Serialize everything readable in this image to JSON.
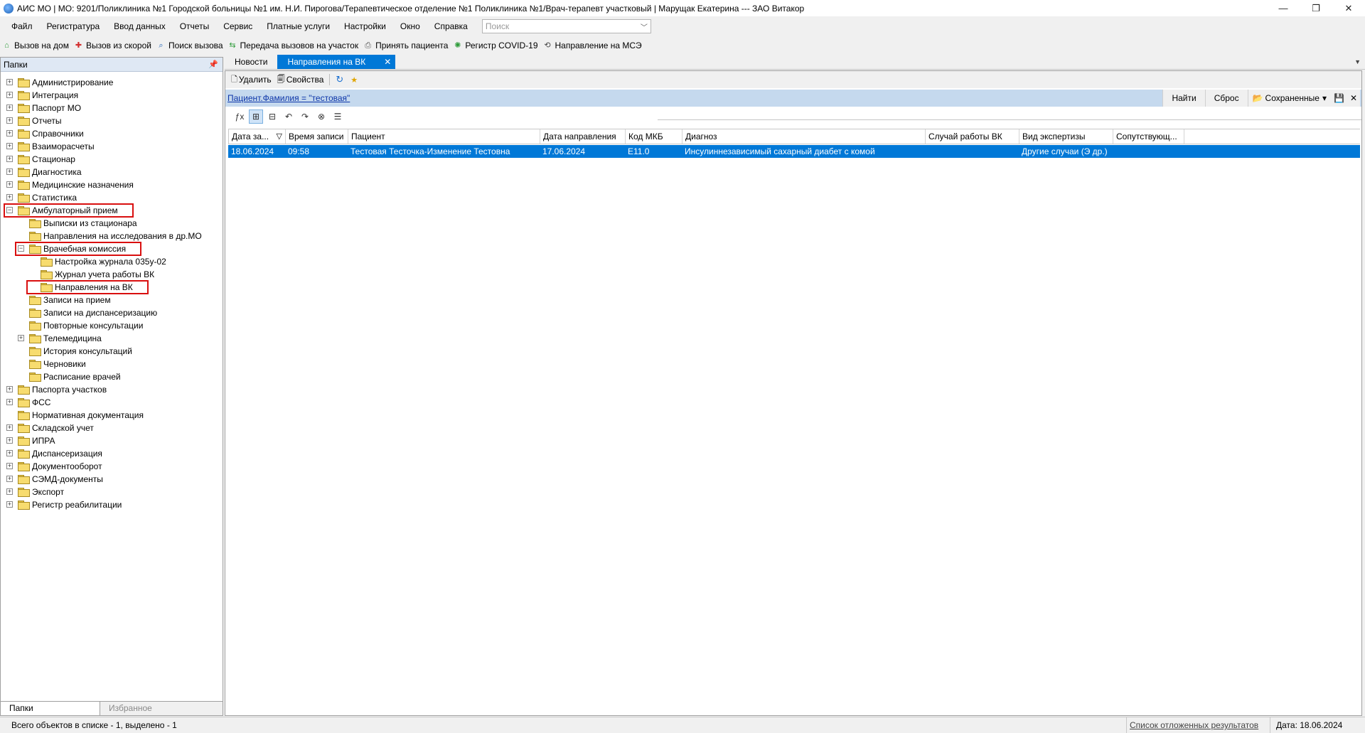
{
  "window": {
    "title": "АИС МО | МО: 9201/Поликлиника №1 Городской больницы №1 им. Н.И. Пирогова/Терапевтическое отделение №1 Поликлиника №1/Врач-терапевт участковый | Марущак Екатерина --- ЗАО Витакор",
    "minimize": "—",
    "maximize": "❐",
    "close": "✕"
  },
  "menu": {
    "items": [
      "Файл",
      "Регистратура",
      "Ввод данных",
      "Отчеты",
      "Сервис",
      "Платные услуги",
      "Настройки",
      "Окно",
      "Справка"
    ],
    "search_placeholder": "Поиск"
  },
  "toolbar": {
    "items": [
      {
        "label": "Вызов на дом",
        "icon": "house-call-icon",
        "color": "#2e9b3a"
      },
      {
        "label": "Вызов из скорой",
        "icon": "ambulance-icon",
        "color": "#d32f2f"
      },
      {
        "label": "Поиск вызова",
        "icon": "search-call-icon",
        "color": "#1a5fb4"
      },
      {
        "label": "Передача вызовов на участок",
        "icon": "transfer-icon",
        "color": "#2e9b3a"
      },
      {
        "label": "Принять пациента",
        "icon": "accept-patient-icon",
        "color": "#555555"
      },
      {
        "label": "Регистр COVID-19",
        "icon": "covid-icon",
        "color": "#2e9b3a"
      },
      {
        "label": "Направление на МСЭ",
        "icon": "mse-icon",
        "color": "#444444"
      }
    ]
  },
  "left_panel": {
    "title": "Папки",
    "pin": "ᵖ",
    "tree": [
      {
        "label": "Администрирование",
        "level": 0,
        "exp": "+"
      },
      {
        "label": "Интеграция",
        "level": 0,
        "exp": "+"
      },
      {
        "label": "Паспорт МО",
        "level": 0,
        "exp": "+"
      },
      {
        "label": "Отчеты",
        "level": 0,
        "exp": "+"
      },
      {
        "label": "Справочники",
        "level": 0,
        "exp": "+"
      },
      {
        "label": "Взаиморасчеты",
        "level": 0,
        "exp": "+"
      },
      {
        "label": "Стационар",
        "level": 0,
        "exp": "+"
      },
      {
        "label": "Диагностика",
        "level": 0,
        "exp": "+"
      },
      {
        "label": "Медицинские назначения",
        "level": 0,
        "exp": "+"
      },
      {
        "label": "Статистика",
        "level": 0,
        "exp": "+"
      },
      {
        "label": "Амбулаторный прием",
        "level": 0,
        "exp": "−",
        "hl": true
      },
      {
        "label": "Выписки из стационара",
        "level": 1,
        "exp": ""
      },
      {
        "label": "Направления на исследования в др.МО",
        "level": 1,
        "exp": ""
      },
      {
        "label": "Врачебная комиссия",
        "level": 1,
        "exp": "−",
        "hl": true
      },
      {
        "label": "Настройка журнала 035у-02",
        "level": 2,
        "exp": ""
      },
      {
        "label": "Журнал учета работы ВК",
        "level": 2,
        "exp": ""
      },
      {
        "label": "Направления на ВК",
        "level": 2,
        "exp": "",
        "hl": true,
        "open": true
      },
      {
        "label": "Записи на прием",
        "level": 1,
        "exp": ""
      },
      {
        "label": "Записи на диспансеризацию",
        "level": 1,
        "exp": ""
      },
      {
        "label": "Повторные консультации",
        "level": 1,
        "exp": ""
      },
      {
        "label": "Телемедицина",
        "level": 1,
        "exp": "+"
      },
      {
        "label": "История консультаций",
        "level": 1,
        "exp": ""
      },
      {
        "label": "Черновики",
        "level": 1,
        "exp": ""
      },
      {
        "label": "Расписание врачей",
        "level": 1,
        "exp": ""
      },
      {
        "label": "Паспорта участков",
        "level": 0,
        "exp": "+"
      },
      {
        "label": "ФСС",
        "level": 0,
        "exp": "+"
      },
      {
        "label": "Нормативная документация",
        "level": 0,
        "exp": ""
      },
      {
        "label": "Складской учет",
        "level": 0,
        "exp": "+"
      },
      {
        "label": "ИПРА",
        "level": 0,
        "exp": "+"
      },
      {
        "label": "Диспансеризация",
        "level": 0,
        "exp": "+"
      },
      {
        "label": "Документооборот",
        "level": 0,
        "exp": "+"
      },
      {
        "label": "СЭМД-документы",
        "level": 0,
        "exp": "+"
      },
      {
        "label": "Экспорт",
        "level": 0,
        "exp": "+"
      },
      {
        "label": "Регистр реабилитации",
        "level": 0,
        "exp": "+"
      }
    ],
    "bottom_tabs": [
      "Папки",
      "Избранное"
    ]
  },
  "doc_tabs": {
    "tabs": [
      "Новости",
      "Направления на ВК"
    ],
    "close": "✕",
    "overflow": "▼"
  },
  "commands": {
    "delete": "Удалить",
    "properties": "Свойства",
    "refresh_icon": "↻",
    "add_icon": "★"
  },
  "filter": {
    "text": "Пациент.Фамилия = \"тестовая\"",
    "find": "Найти",
    "reset": "Сброс",
    "saved": "Сохраненные",
    "saved_arrow": "▾",
    "save_icon": "💾",
    "close_icon": "✕"
  },
  "grid_tools": [
    "ƒx",
    "⊞",
    "⊟",
    "↶",
    "↷",
    "⊗",
    "☰"
  ],
  "grid": {
    "columns": [
      {
        "label": "Дата за...",
        "w": 80,
        "sort": "▽"
      },
      {
        "label": "Время записи",
        "w": 88
      },
      {
        "label": "Пациент",
        "w": 270
      },
      {
        "label": "Дата направления",
        "w": 120
      },
      {
        "label": "Код МКБ",
        "w": 80
      },
      {
        "label": "Диагноз",
        "w": 342
      },
      {
        "label": "Случай работы ВК",
        "w": 132
      },
      {
        "label": "Вид экспертизы",
        "w": 132
      },
      {
        "label": "Сопутствующ...",
        "w": 100
      }
    ],
    "rows": [
      [
        "18.06.2024",
        "09:58",
        "Тестовая Тесточка-Изменение Тестовна",
        "17.06.2024",
        "E11.0",
        "Инсулиннезависимый сахарный диабет с комой",
        "",
        "Другие случаи (Э др.)",
        ""
      ]
    ]
  },
  "status": {
    "left": "Всего объектов в списке - 1, выделено - 1",
    "deferred_link": "Список отложенных результатов",
    "date": "Дата: 18.06.2024"
  }
}
